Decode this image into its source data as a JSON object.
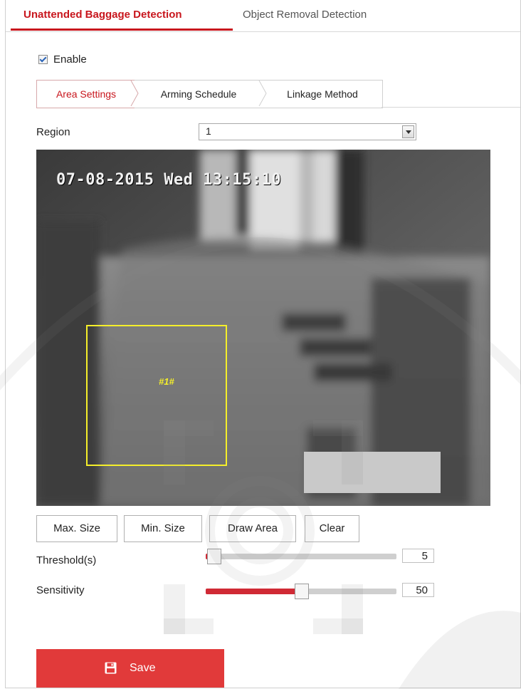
{
  "top_tabs": {
    "active_label": "Unattended Baggage Detection",
    "inactive_label": "Object Removal Detection"
  },
  "enable": {
    "label": "Enable",
    "checked": true
  },
  "sub_tabs": [
    {
      "label": "Area Settings",
      "active": true
    },
    {
      "label": "Arming Schedule",
      "active": false
    },
    {
      "label": "Linkage Method",
      "active": false
    }
  ],
  "region": {
    "label": "Region",
    "value": "1"
  },
  "video": {
    "timestamp": "07-08-2015 Wed 13:15:10",
    "region_tag": "#1#"
  },
  "buttons": {
    "max_size": "Max. Size",
    "min_size": "Min. Size",
    "draw_area": "Draw Area",
    "clear": "Clear"
  },
  "threshold": {
    "label": "Threshold(s)",
    "value": "5",
    "level": 0.04
  },
  "sensitivity": {
    "label": "Sensitivity",
    "value": "50",
    "level": 0.5
  },
  "save": {
    "label": "Save",
    "icon": "floppy-disk-icon"
  },
  "colors": {
    "accent": "#c8161d",
    "save_bg": "#e13a3a",
    "detect_box": "#f5ef2a"
  }
}
